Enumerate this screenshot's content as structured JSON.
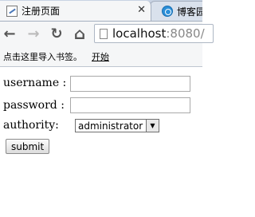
{
  "browser": {
    "tabs": [
      {
        "title": "注册页面",
        "close_glyph": "✕",
        "favicon": "page-favicon",
        "active": true
      },
      {
        "title": "博客园",
        "favicon": "blog-favicon",
        "active": false
      }
    ],
    "toolbar": {
      "back_glyph": "←",
      "forward_glyph": "→",
      "reload_glyph": "↻",
      "home_glyph": "⌂",
      "url_host": "localhost",
      "url_port": ":8080/"
    },
    "bookmarks_bar": {
      "hint": "点击这里导入书签。",
      "start_link": "开始"
    }
  },
  "form": {
    "username_label": "username :",
    "username_value": "",
    "password_label": "password :",
    "password_value": "",
    "authority_label": "authority:",
    "authority_selected": "administrator",
    "select_arrow_glyph": "▼",
    "submit_label": "submit"
  },
  "colors": {
    "tabstrip": "#c8d3e3",
    "toolbar": "#f5f6f7",
    "page_background": "#ffffff"
  }
}
